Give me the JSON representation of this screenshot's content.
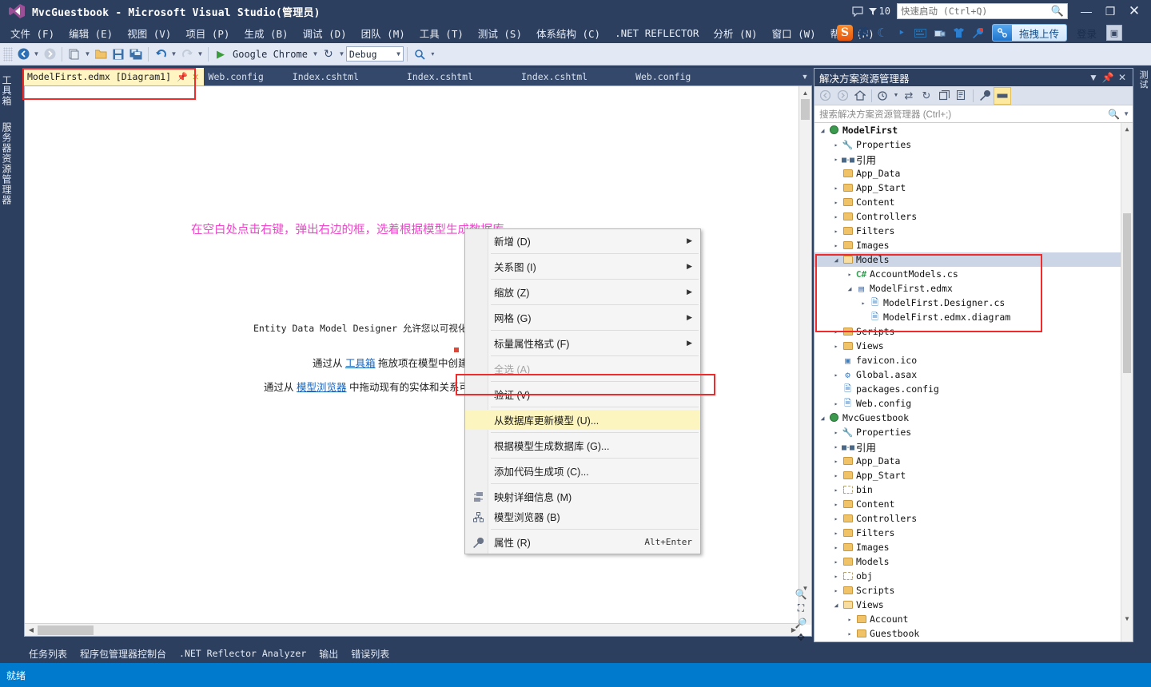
{
  "titlebar": {
    "title": "MvcGuestbook - Microsoft Visual Studio(管理员)",
    "logo_icon": "visual-studio-logo-icon",
    "feedback_icon": "feedback-icon",
    "notification_icon": "notification-funnel-icon",
    "notification_count": "10",
    "quick_launch_placeholder": "快速启动 (Ctrl+Q)",
    "quick_launch_value": "",
    "search_icon": "search-icon",
    "minimize": "—",
    "restore": "❐",
    "close": "✕"
  },
  "menubar": {
    "items": [
      {
        "label": "文件 (F)"
      },
      {
        "label": "编辑 (E)"
      },
      {
        "label": "视图 (V)"
      },
      {
        "label": "项目 (P)"
      },
      {
        "label": "生成 (B)"
      },
      {
        "label": "调试 (D)"
      },
      {
        "label": "团队 (M)"
      },
      {
        "label": "工具 (T)"
      },
      {
        "label": "测试 (S)"
      },
      {
        "label": "体系结构 (C)"
      },
      {
        "label": ".NET REFLECTOR"
      },
      {
        "label": "分析 (N)"
      },
      {
        "label": "窗口 (W)"
      },
      {
        "label": "帮助 (H)"
      }
    ]
  },
  "ime": {
    "logo": "S",
    "mode_label": "英",
    "icons": [
      "moon-icon",
      "comma-icon",
      "keyboard-icon",
      "toolbox-icon",
      "skin-icon",
      "wrench-icon"
    ],
    "upload_label": "拖拽上传",
    "upload_icon": "cloud-upload-icon",
    "login_label": "登录",
    "tray_icon": "tray-icon"
  },
  "toolbar": {
    "grip_icon": "toolbar-grip-icon",
    "nav_back_icon": "navigate-back-icon",
    "nav_forward_icon": "navigate-forward-icon",
    "new_item_icon": "new-item-icon",
    "open_file_icon": "open-file-icon",
    "save_icon": "save-icon",
    "save_all_icon": "save-all-icon",
    "undo_icon": "undo-icon",
    "redo_icon": "redo-icon",
    "start_icon": "start-debug-icon",
    "start_label": "Google Chrome",
    "refresh_icon": "refresh-icon",
    "config_value": "Debug",
    "find_icon": "find-icon",
    "overflow_icon": "toolbar-overflow-icon"
  },
  "left_tool_tabs": [
    {
      "label": "工具箱"
    },
    {
      "label": "服务器资源管理器"
    }
  ],
  "right_tool_tabs": [
    {
      "label": "测试"
    }
  ],
  "document_tabs": {
    "overflow_icon": "tab-overflow-icon",
    "items": [
      {
        "label": "ModelFirst.edmx [Diagram1]",
        "active": true,
        "pin_icon": "pin-icon",
        "close_icon": "close-icon"
      },
      {
        "label": "Web.config",
        "active": false
      },
      {
        "label": "Index.cshtml",
        "active": false
      },
      {
        "label": "Index.cshtml",
        "active": false
      },
      {
        "label": "Index.cshtml",
        "active": false
      },
      {
        "label": "Web.config",
        "active": false
      }
    ]
  },
  "designer": {
    "annotation": "在空白处点击右键，弹出右边的框，选着根据模型生成数据库",
    "annotation_color": "#ee44cc",
    "line1": "Entity Data Model Designer 允许您以可视化方",
    "line2_prefix": "通过从 ",
    "line2_link": "工具箱",
    "line2_suffix": " 拖放项在模型中创建",
    "line3_prefix": "通过从 ",
    "line3_link": "模型浏览器",
    "line3_suffix": " 中拖动现有的实体和关系可",
    "zoom_in_icon": "zoom-in-icon",
    "zoom_fit_icon": "zoom-fit-icon",
    "zoom_out_icon": "zoom-out-icon",
    "pan_icon": "pan-icon"
  },
  "context_menu": {
    "items": [
      {
        "label": "新增 (D)",
        "submenu": true,
        "icon": null,
        "accel": "",
        "disabled": false,
        "highlighted": false
      },
      {
        "sep": true
      },
      {
        "label": "关系图 (I)",
        "submenu": true,
        "icon": null,
        "accel": "",
        "disabled": false,
        "highlighted": false
      },
      {
        "sep": true
      },
      {
        "label": "缩放 (Z)",
        "submenu": true,
        "icon": null,
        "accel": "",
        "disabled": false,
        "highlighted": false
      },
      {
        "sep": true
      },
      {
        "label": "网格 (G)",
        "submenu": true,
        "icon": null,
        "accel": "",
        "disabled": false,
        "highlighted": false
      },
      {
        "sep": true
      },
      {
        "label": "标量属性格式 (F)",
        "submenu": true,
        "icon": null,
        "accel": "",
        "disabled": false,
        "highlighted": false
      },
      {
        "sep": true
      },
      {
        "label": "全选 (A)",
        "submenu": false,
        "icon": null,
        "accel": "",
        "disabled": true,
        "highlighted": false
      },
      {
        "sep": true
      },
      {
        "label": "验证 (V)",
        "submenu": false,
        "icon": null,
        "accel": "",
        "disabled": false,
        "highlighted": false
      },
      {
        "sep": true
      },
      {
        "label": "从数据库更新模型 (U)...",
        "submenu": false,
        "icon": null,
        "accel": "",
        "disabled": false,
        "highlighted": true
      },
      {
        "sep": true
      },
      {
        "label": "根据模型生成数据库 (G)...",
        "submenu": false,
        "icon": null,
        "accel": "",
        "disabled": false,
        "highlighted": false
      },
      {
        "sep": true
      },
      {
        "label": "添加代码生成项 (C)...",
        "submenu": false,
        "icon": null,
        "accel": "",
        "disabled": false,
        "highlighted": false
      },
      {
        "sep": true
      },
      {
        "label": "映射详细信息 (M)",
        "submenu": false,
        "icon": "mapping-details-icon",
        "accel": "",
        "disabled": false,
        "highlighted": false
      },
      {
        "label": "模型浏览器 (B)",
        "submenu": false,
        "icon": "model-browser-icon",
        "accel": "",
        "disabled": false,
        "highlighted": false
      },
      {
        "sep": true
      },
      {
        "label": "属性 (R)",
        "submenu": false,
        "icon": "properties-wrench-icon",
        "accel": "Alt+Enter",
        "disabled": false,
        "highlighted": false
      }
    ]
  },
  "solution_explorer": {
    "title": "解决方案资源管理器",
    "dropdown_icon": "chevron-down-icon",
    "pin_icon": "pin-icon",
    "close_icon": "close-icon",
    "toolbar_icons": [
      "nav-back-icon",
      "nav-forward-icon",
      "home-icon",
      "pending-changes-icon",
      "sync-icon",
      "refresh-icon",
      "collapse-all-icon",
      "show-all-files-icon",
      "properties-wrench-icon",
      "preview-selected-items-icon"
    ],
    "search_placeholder": "搜索解决方案资源管理器 (Ctrl+;)",
    "search_value": "",
    "search_icon": "search-icon",
    "tree": [
      {
        "depth": 0,
        "arrow": "down",
        "icon": "project-icon",
        "label": "ModelFirst",
        "bold": true,
        "selected": false
      },
      {
        "depth": 1,
        "arrow": "right",
        "icon": "wrench-icon",
        "label": "Properties",
        "bold": false,
        "selected": false
      },
      {
        "depth": 1,
        "arrow": "right",
        "icon": "references-icon",
        "label": "引用",
        "cjk": true,
        "bold": false,
        "selected": false
      },
      {
        "depth": 1,
        "arrow": "none",
        "icon": "folder-icon",
        "label": "App_Data",
        "bold": false,
        "selected": false
      },
      {
        "depth": 1,
        "arrow": "right",
        "icon": "folder-icon",
        "label": "App_Start",
        "bold": false,
        "selected": false
      },
      {
        "depth": 1,
        "arrow": "right",
        "icon": "folder-icon",
        "label": "Content",
        "bold": false,
        "selected": false
      },
      {
        "depth": 1,
        "arrow": "right",
        "icon": "folder-icon",
        "label": "Controllers",
        "bold": false,
        "selected": false
      },
      {
        "depth": 1,
        "arrow": "right",
        "icon": "folder-icon",
        "label": "Filters",
        "bold": false,
        "selected": false
      },
      {
        "depth": 1,
        "arrow": "right",
        "icon": "folder-icon",
        "label": "Images",
        "bold": false,
        "selected": false
      },
      {
        "depth": 1,
        "arrow": "down",
        "icon": "folder-open-icon",
        "label": "Models",
        "bold": false,
        "selected": true
      },
      {
        "depth": 2,
        "arrow": "right",
        "icon": "csharp-icon",
        "label": "AccountModels.cs",
        "bold": false,
        "selected": false
      },
      {
        "depth": 2,
        "arrow": "down",
        "icon": "edmx-icon",
        "label": "ModelFirst.edmx",
        "bold": false,
        "selected": false
      },
      {
        "depth": 3,
        "arrow": "right",
        "icon": "file-icon",
        "label": "ModelFirst.Designer.cs",
        "bold": false,
        "selected": false
      },
      {
        "depth": 3,
        "arrow": "none",
        "icon": "file-icon",
        "label": "ModelFirst.edmx.diagram",
        "bold": false,
        "selected": false
      },
      {
        "depth": 1,
        "arrow": "right",
        "icon": "folder-icon",
        "label": "Scripts",
        "bold": false,
        "selected": false
      },
      {
        "depth": 1,
        "arrow": "right",
        "icon": "folder-icon",
        "label": "Views",
        "bold": false,
        "selected": false
      },
      {
        "depth": 1,
        "arrow": "none",
        "icon": "icon-file-icon",
        "label": "favicon.ico",
        "bold": false,
        "selected": false
      },
      {
        "depth": 1,
        "arrow": "right",
        "icon": "asax-icon",
        "label": "Global.asax",
        "bold": false,
        "selected": false
      },
      {
        "depth": 1,
        "arrow": "none",
        "icon": "config-icon",
        "label": "packages.config",
        "bold": false,
        "selected": false
      },
      {
        "depth": 1,
        "arrow": "right",
        "icon": "config-icon",
        "label": "Web.config",
        "bold": false,
        "selected": false
      },
      {
        "depth": 0,
        "arrow": "down",
        "icon": "project-icon",
        "label": "MvcGuestbook",
        "bold": false,
        "selected": false
      },
      {
        "depth": 1,
        "arrow": "right",
        "icon": "wrench-icon",
        "label": "Properties",
        "bold": false,
        "selected": false
      },
      {
        "depth": 1,
        "arrow": "right",
        "icon": "references-icon",
        "label": "引用",
        "cjk": true,
        "bold": false,
        "selected": false
      },
      {
        "depth": 1,
        "arrow": "right",
        "icon": "folder-icon",
        "label": "App_Data",
        "bold": false,
        "selected": false
      },
      {
        "depth": 1,
        "arrow": "right",
        "icon": "folder-icon",
        "label": "App_Start",
        "bold": false,
        "selected": false
      },
      {
        "depth": 1,
        "arrow": "right",
        "icon": "folder-dashed-icon",
        "label": "bin",
        "bold": false,
        "selected": false
      },
      {
        "depth": 1,
        "arrow": "right",
        "icon": "folder-icon",
        "label": "Content",
        "bold": false,
        "selected": false
      },
      {
        "depth": 1,
        "arrow": "right",
        "icon": "folder-icon",
        "label": "Controllers",
        "bold": false,
        "selected": false
      },
      {
        "depth": 1,
        "arrow": "right",
        "icon": "folder-icon",
        "label": "Filters",
        "bold": false,
        "selected": false
      },
      {
        "depth": 1,
        "arrow": "right",
        "icon": "folder-icon",
        "label": "Images",
        "bold": false,
        "selected": false
      },
      {
        "depth": 1,
        "arrow": "right",
        "icon": "folder-icon",
        "label": "Models",
        "bold": false,
        "selected": false
      },
      {
        "depth": 1,
        "arrow": "right",
        "icon": "folder-dashed-icon",
        "label": "obj",
        "bold": false,
        "selected": false
      },
      {
        "depth": 1,
        "arrow": "right",
        "icon": "folder-icon",
        "label": "Scripts",
        "bold": false,
        "selected": false
      },
      {
        "depth": 1,
        "arrow": "down",
        "icon": "folder-open-icon",
        "label": "Views",
        "bold": false,
        "selected": false
      },
      {
        "depth": 2,
        "arrow": "right",
        "icon": "folder-icon",
        "label": "Account",
        "bold": false,
        "selected": false
      },
      {
        "depth": 2,
        "arrow": "right",
        "icon": "folder-icon",
        "label": "Guestbook",
        "bold": false,
        "selected": false
      }
    ]
  },
  "bottom_tabs": [
    {
      "label": "任务列表",
      "mono": false
    },
    {
      "label": "程序包管理器控制台",
      "mono": false
    },
    {
      "label": ".NET Reflector Analyzer",
      "mono": true
    },
    {
      "label": "输出",
      "mono": false
    },
    {
      "label": "错误列表",
      "mono": false
    }
  ],
  "statusbar": {
    "text": "就绪",
    "color": "#007acc"
  }
}
